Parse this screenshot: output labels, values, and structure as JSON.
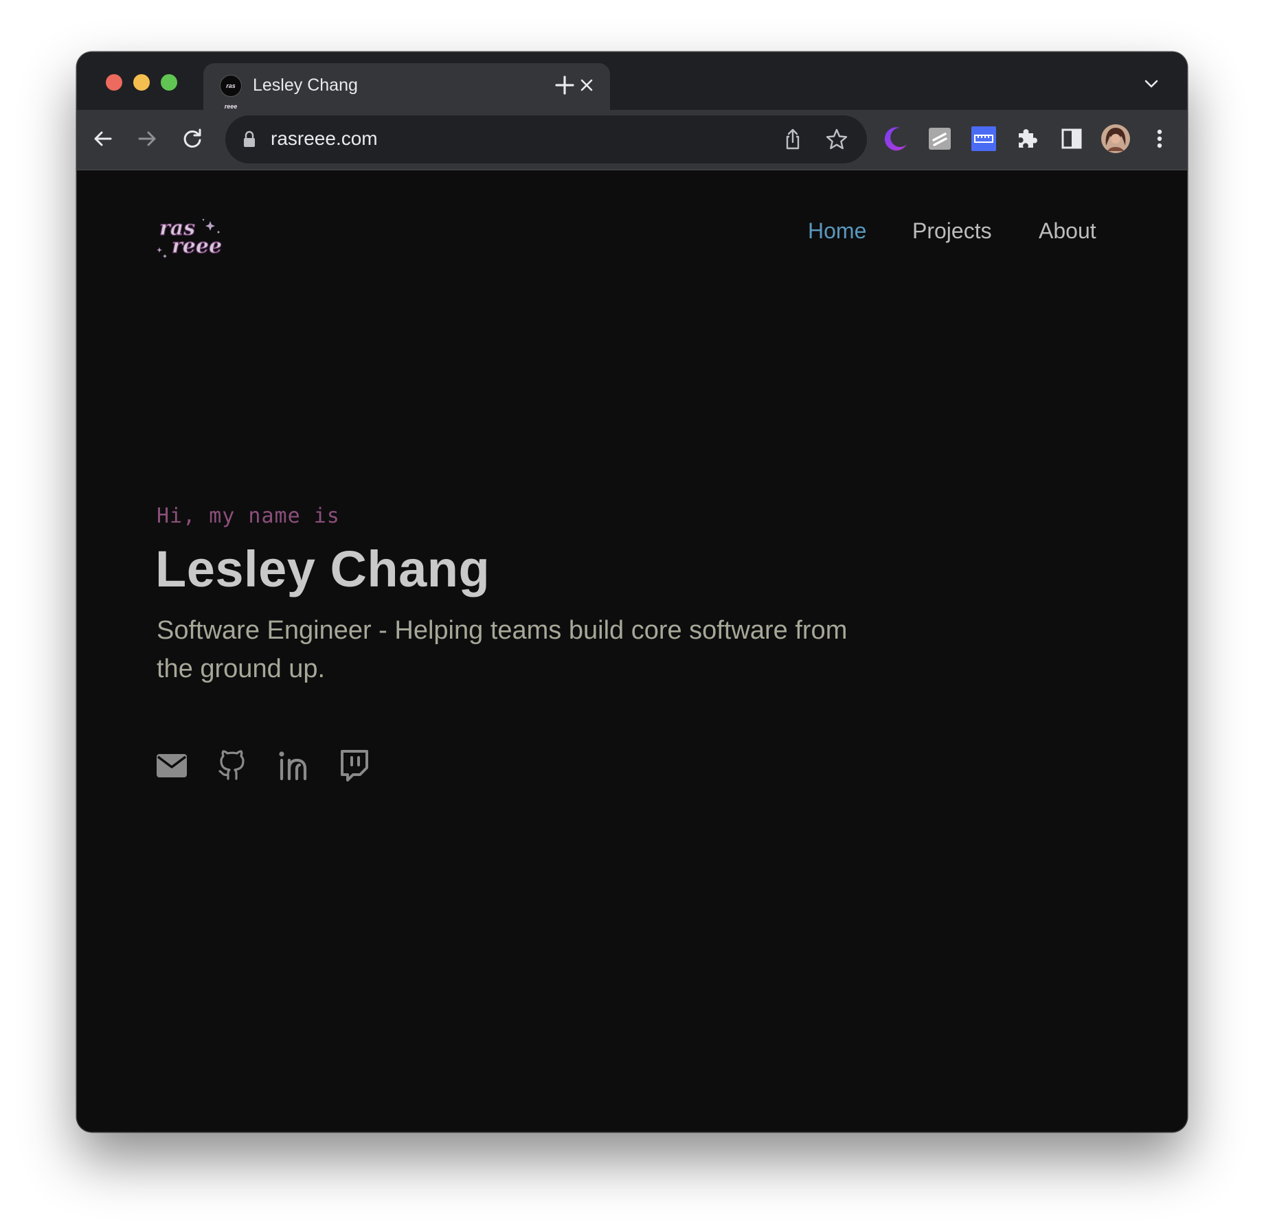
{
  "browser": {
    "tab": {
      "title": "Lesley Chang",
      "favicon_text": "ras reee"
    },
    "omnibox": {
      "url": "rasreee.com"
    },
    "icons": {
      "close": "close-icon",
      "new_tab": "plus-icon",
      "tab_search": "chevron-down-icon",
      "back": "back-arrow-icon",
      "forward": "forward-arrow-icon",
      "reload": "reload-icon",
      "lock": "lock-icon",
      "share": "share-icon",
      "bookmark": "star-icon",
      "extensions": [
        "moon-extension-icon",
        "notes-extension-icon",
        "ruler-extension-icon",
        "puzzle-icon",
        "side-panel-icon",
        "profile-avatar",
        "kebab-menu-icon"
      ]
    }
  },
  "site": {
    "logo_text": "ras reee",
    "nav": {
      "home": "Home",
      "projects": "Projects",
      "about": "About"
    },
    "hero": {
      "intro": "Hi, my name is",
      "name": "Lesley Chang",
      "tagline": "Software Engineer - Helping teams build core software from the ground up."
    },
    "social": [
      "mail-icon",
      "github-icon",
      "linkedin-icon",
      "twitch-icon"
    ]
  },
  "colors": {
    "nav_active": "#5a98bd",
    "intro": "#8c4f7a",
    "name": "#c9c9c9",
    "tagline": "#a7a898",
    "page_bg": "#0d0d0e"
  }
}
